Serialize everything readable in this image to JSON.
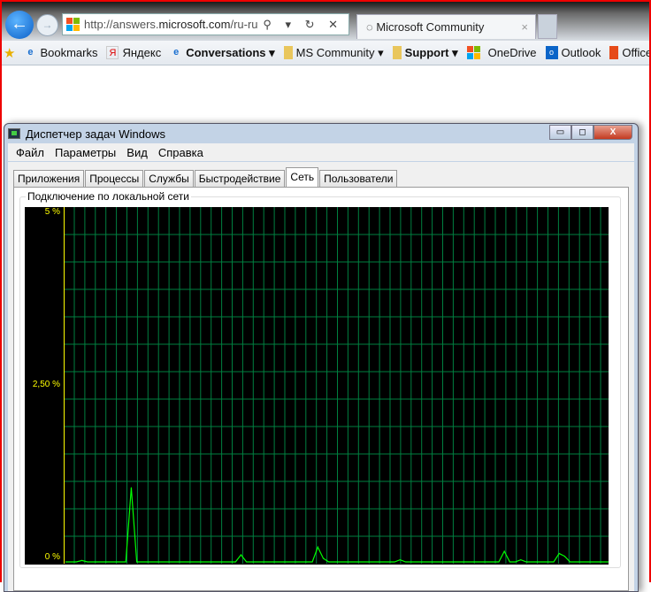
{
  "browser": {
    "address": {
      "prefix": "http://answers.",
      "domain": "microsoft.com",
      "path": "/ru-ru"
    },
    "address_tools": "⚲ ▾ ↻ ✕",
    "tab": {
      "title": "Microsoft Community",
      "close": "×"
    },
    "favorites": [
      {
        "label": "Bookmarks",
        "icon": "ie-icon"
      },
      {
        "label": "Яндекс",
        "icon": "yandex-icon"
      },
      {
        "label": "Conversations ▾",
        "icon": "ie-icon",
        "bold": true
      },
      {
        "label": "MS Community ▾",
        "icon": "folder-icon"
      },
      {
        "label": "Support ▾",
        "icon": "folder-icon",
        "bold": true
      },
      {
        "label": "OneDrive",
        "icon": "ms-logo-icon"
      },
      {
        "label": "Outlook",
        "icon": "outlook-icon"
      },
      {
        "label": "Office Online",
        "icon": "office-icon"
      }
    ]
  },
  "window": {
    "title": "Диспетчер задач Windows",
    "menu": [
      "Файл",
      "Параметры",
      "Вид",
      "Справка"
    ],
    "tabs": [
      "Приложения",
      "Процессы",
      "Службы",
      "Быстродействие",
      "Сеть",
      "Пользователи"
    ],
    "active_tab": "Сеть",
    "group_label": "Подключение по локальной сети"
  },
  "chart_data": {
    "type": "line",
    "y_tick_labels": [
      "5 %",
      "2,50 %",
      "0 %"
    ],
    "ylim": [
      0,
      5
    ],
    "grid": true,
    "series_color": "#00ff00",
    "grid_color": "#008040",
    "values": [
      0,
      0,
      0,
      0.02,
      0,
      0,
      0,
      0,
      0,
      0,
      0,
      0,
      1.05,
      0,
      0,
      0,
      0,
      0,
      0,
      0,
      0,
      0,
      0,
      0,
      0,
      0,
      0,
      0,
      0,
      0,
      0,
      0,
      0.1,
      0,
      0,
      0,
      0,
      0,
      0,
      0,
      0,
      0,
      0,
      0,
      0,
      0,
      0.21,
      0.05,
      0,
      0,
      0,
      0,
      0,
      0,
      0,
      0,
      0,
      0,
      0,
      0,
      0,
      0.03,
      0,
      0,
      0,
      0,
      0,
      0,
      0,
      0,
      0,
      0,
      0,
      0,
      0,
      0,
      0,
      0,
      0,
      0,
      0.15,
      0,
      0,
      0.03,
      0,
      0,
      0,
      0,
      0,
      0,
      0.12,
      0.08,
      0,
      0,
      0,
      0,
      0,
      0,
      0,
      0
    ]
  }
}
